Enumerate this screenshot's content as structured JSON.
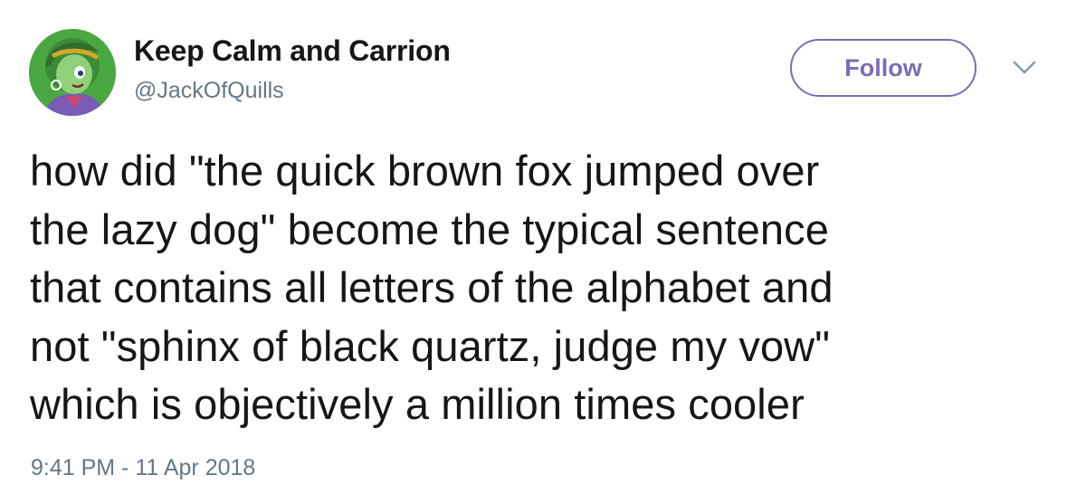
{
  "tweet": {
    "author": {
      "display_name": "Keep Calm and Carrion",
      "handle": "@JackOfQuills",
      "avatar_icon": "avatar-image"
    },
    "follow_button_label": "Follow",
    "more_menu_icon": "chevron-down-icon",
    "text": "how did \"the quick brown fox jumped over\nthe lazy dog\" become the typical sentence\nthat contains all letters of the alphabet and\nnot \"sphinx of black quartz, judge my vow\"\nwhich is objectively a million times cooler",
    "timestamp": "9:41 PM - 11 Apr 2018"
  },
  "colors": {
    "accent": "#7d6bb8",
    "secondary_text": "#657786",
    "primary_text": "#14171a"
  }
}
